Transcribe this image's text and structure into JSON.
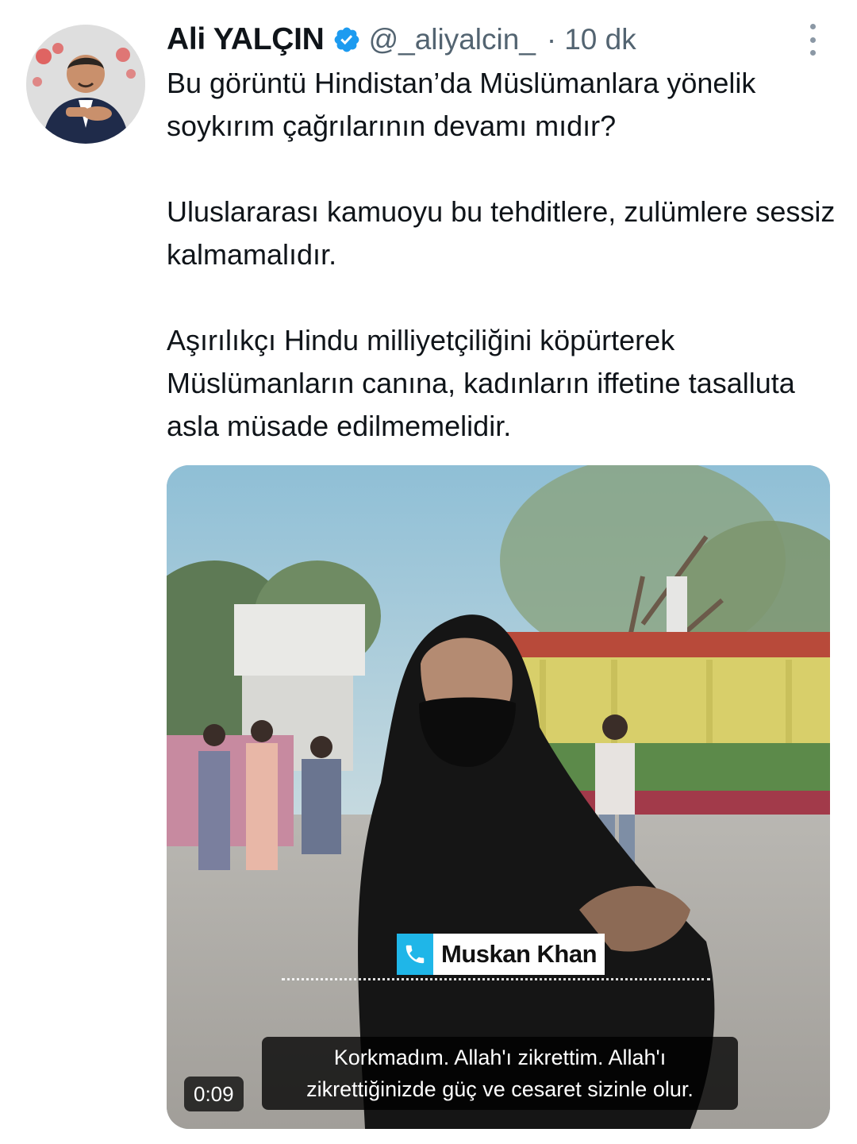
{
  "tweet": {
    "author_name": "Ali YALÇIN",
    "handle": "@_aliyalcin_",
    "separator": "·",
    "time": "10 dk",
    "verified": true,
    "paragraphs": [
      "Bu görüntü Hindistan’da Müslümanlara yönelik soykırım çağrılarının devamı mıdır?",
      "Uluslararası kamuoyu bu tehditlere, zulümlere sessiz kalmamalıdır.",
      "Aşırılıkçı Hindu milliyetçiliğini köpürterek Müslümanların canına, kadınların iffetine tasalluta asla müsade edilmemelidir."
    ],
    "icons": {
      "verified": "verified-badge-icon",
      "more": "more-options-icon"
    },
    "colors": {
      "verified_badge": "#1d9bf0",
      "secondary_text": "#536471"
    }
  },
  "video": {
    "name_tag": "Muskan Khan",
    "subtitle_line1": "Korkmadım. Allah'ı zikrettim. Allah'ı",
    "subtitle_line2": "zikrettiğinizde güç ve cesaret sizinle olur.",
    "duration": "0:09",
    "icons": {
      "name_tag": "phone-icon"
    },
    "colors": {
      "name_tag_accent": "#1fb6e8"
    }
  }
}
